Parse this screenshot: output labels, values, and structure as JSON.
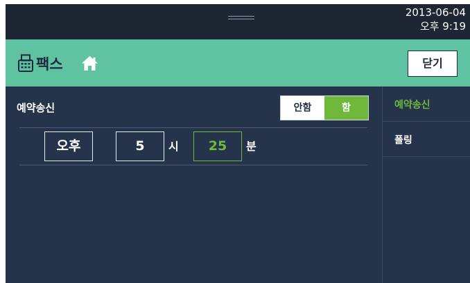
{
  "statusbar": {
    "date": "2013-06-04",
    "time": "오후 9:19"
  },
  "header": {
    "title": "팩스",
    "close_label": "닫기"
  },
  "reservation": {
    "label": "예약송신",
    "toggle_off": "안함",
    "toggle_on": "함",
    "toggle_selected": "함"
  },
  "time_setting": {
    "ampm": "오후",
    "hour": "5",
    "hour_unit": "시",
    "minute": "25",
    "minute_unit": "분"
  },
  "sidebar": {
    "items": [
      {
        "label": "예약송신",
        "active": true
      },
      {
        "label": "폴링",
        "active": false
      }
    ]
  },
  "colors": {
    "accent": "#5fc3a1",
    "active_green": "#6fb83c",
    "background": "#25344a",
    "statusbar": "#1e2533"
  },
  "icons": {
    "title_icon": "fax-icon",
    "home_icon": "home-icon"
  }
}
